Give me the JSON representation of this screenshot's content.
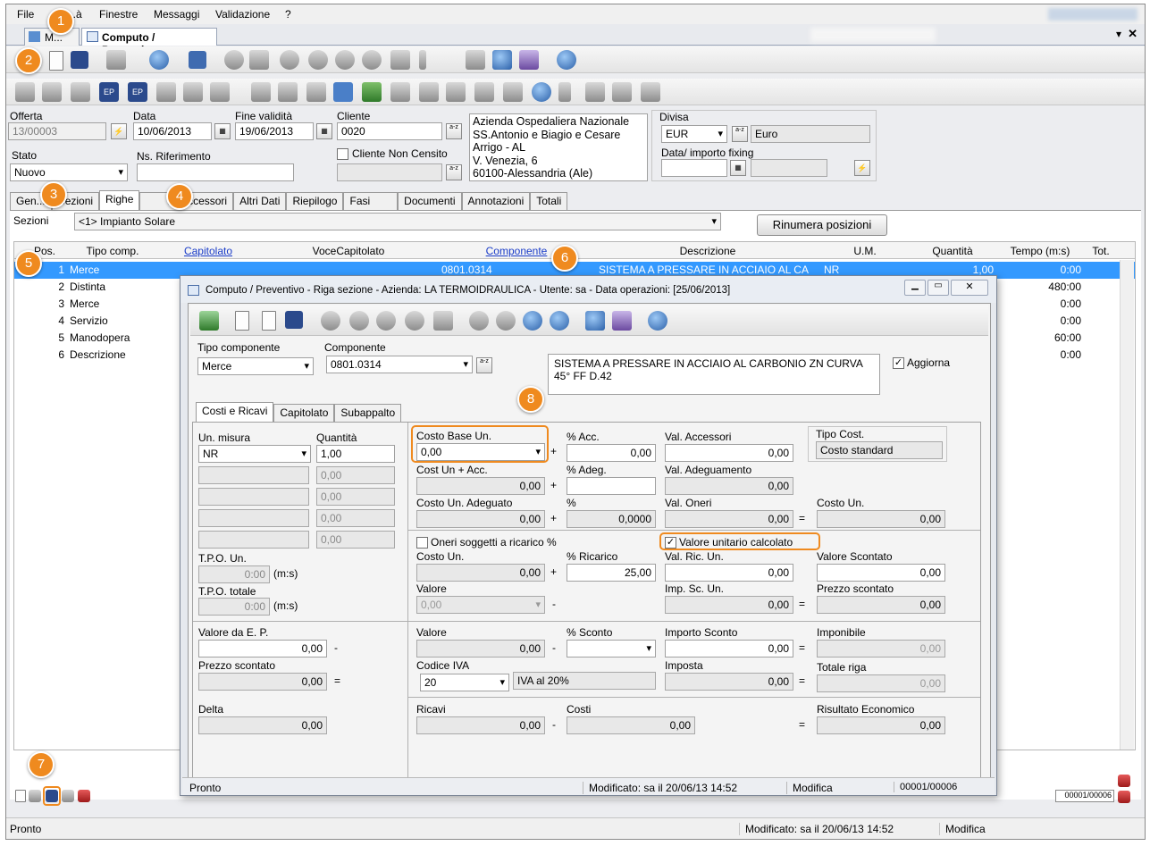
{
  "menu": [
    "File",
    "...à",
    "Finestre",
    "Messaggi",
    "Validazione",
    "?"
  ],
  "doc_tabs": {
    "first": "M...",
    "active": "Computo / Preventivo"
  },
  "header": {
    "offerta_label": "Offerta",
    "offerta": "13/00003",
    "data_label": "Data",
    "data": "10/06/2013",
    "fine_label": "Fine validità",
    "fine": "19/06/2013",
    "cliente_label": "Cliente",
    "cliente": "0020",
    "address": [
      "Azienda Ospedaliera Nazionale",
      "SS.Antonio e Biagio e Cesare",
      "Arrigo - AL",
      "V. Venezia, 6",
      "60100-Alessandria (Ale)"
    ],
    "divisa_label": "Divisa",
    "divisa": "EUR",
    "divisa_desc": "Euro",
    "fixing_label": "Data/ importo fixing",
    "stato_label": "Stato",
    "stato": "Nuovo",
    "nsrif_label": "Ns. Riferimento",
    "non_censito_label": "Cliente Non Censito"
  },
  "main_tabs": [
    "Gen...",
    "Sezioni",
    "Righe",
    "...i accessori",
    "Altri Dati",
    "Riepilogo",
    "Fasi",
    "Documenti",
    "Annotazioni",
    "Totali"
  ],
  "sezioni_label": "Sezioni",
  "sezioni_value": "<1> Impianto Solare",
  "rinumera": "Rinumera posizioni",
  "grid": {
    "headers": [
      "Pos.",
      "Tipo comp.",
      "Capitolato",
      "VoceCapitolato",
      "Componente",
      "Descrizione",
      "U.M.",
      "Quantità",
      "Tempo (m:s)",
      "Tot."
    ],
    "rows": [
      {
        "pos": "1",
        "tipo": "Merce",
        "comp": "0801.0314",
        "desc": "SISTEMA A PRESSARE IN ACCIAIO AL CA",
        "um": "NR",
        "qta": "1,00",
        "tempo": "0:00"
      },
      {
        "pos": "2",
        "tipo": "Distinta",
        "tempo": "480:00"
      },
      {
        "pos": "3",
        "tipo": "Merce",
        "tempo": "0:00"
      },
      {
        "pos": "4",
        "tipo": "Servizio",
        "tempo": "0:00"
      },
      {
        "pos": "5",
        "tipo": "Manodopera",
        "tempo": "60:00"
      },
      {
        "pos": "6",
        "tipo": "Descrizione",
        "tempo": "0:00"
      }
    ]
  },
  "status": {
    "left": "Pronto",
    "mod": "Modificato: sa il 20/06/13 14:52",
    "mode": "Modifica",
    "counter": "00001/00006"
  },
  "badges": [
    "1",
    "2",
    "3",
    "4",
    "5",
    "6",
    "7",
    "8"
  ],
  "dialog": {
    "title": "Computo / Preventivo - Riga sezione - Azienda: LA TERMOIDRAULICA - Utente: sa - Data operazioni: [25/06/2013]",
    "tipo_comp_label": "Tipo componente",
    "tipo_comp": "Merce",
    "componente_label": "Componente",
    "componente": "0801.0314",
    "descrizione": "SISTEMA A PRESSARE IN ACCIAIO AL CARBONIO ZN CURVA 45° FF D.42",
    "aggiorna": "Aggiorna",
    "tabs": [
      "Costi e Ricavi",
      "Capitolato",
      "Subappalto"
    ],
    "un_misura_label": "Un. misura",
    "un_misura": "NR",
    "quantita_label": "Quantità",
    "quantita": "1,00",
    "zero": "0,00",
    "tpo_un_label": "T.P.O. Un.",
    "tpo_totale_label": "T.P.O. totale",
    "tpo_val": "0:00",
    "ms": "(m:s)",
    "costo_base_label": "Costo Base Un.",
    "costo_base": "0,00",
    "acc_label": "% Acc.",
    "acc": "0,00",
    "val_acc_label": "Val. Accessori",
    "val_acc": "0,00",
    "tipo_cost_label": "Tipo Cost.",
    "tipo_cost": "Costo standard",
    "cost_un_acc_label": "Cost Un + Acc.",
    "cost_un_acc": "0,00",
    "adeg_label": "% Adeg.",
    "val_adeg_label": "Val. Adeguamento",
    "val_adeg": "0,00",
    "costo_un_adeg_label": "Costo Un. Adeguato",
    "costo_un_adeg": "0,00",
    "perc_label": "%",
    "perc": "0,0000",
    "val_oneri_label": "Val. Oneri",
    "val_oneri": "0,00",
    "costo_un_label": "Costo Un.",
    "costo_un": "0,00",
    "oneri_ricarico": "Oneri soggetti a ricarico %",
    "valore_unitario": "Valore unitario calcolato",
    "costo_un2_label": "Costo Un.",
    "costo_un2": "0,00",
    "ricarico_label": "% Ricarico",
    "ricarico": "25,00",
    "val_ric_label": "Val. Ric. Un.",
    "val_ric": "0,00",
    "valore_scontato_label": "Valore Scontato",
    "valore_scontato": "0,00",
    "valore_label": "Valore",
    "valore": "0,00",
    "imp_sc_label": "Imp. Sc. Un.",
    "imp_sc": "0,00",
    "prezzo_scontato_label": "Prezzo scontato",
    "prezzo_scontato": "0,00",
    "valore_ep_label": "Valore da E. P.",
    "valore_ep": "0,00",
    "valore2_label": "Valore",
    "valore2": "0,00",
    "sconto_label": "% Sconto",
    "importo_sconto_label": "Importo Sconto",
    "importo_sconto": "0,00",
    "imponibile_label": "Imponibile",
    "imponibile": "0,00",
    "prezzo_sc2_label": "Prezzo scontato",
    "prezzo_sc2": "0,00",
    "codice_iva_label": "Codice IVA",
    "codice_iva": "20",
    "iva_desc": "IVA al 20%",
    "imposta_label": "Imposta",
    "imposta": "0,00",
    "totale_riga_label": "Totale riga",
    "totale_riga": "0,00",
    "delta_label": "Delta",
    "delta": "0,00",
    "ricavi_label": "Ricavi",
    "ricavi": "0,00",
    "costi_label": "Costi",
    "costi": "0,00",
    "risultato_label": "Risultato Economico",
    "risultato": "0,00",
    "status": {
      "left": "Pronto",
      "mod": "Modificato: sa il 20/06/13 14:52",
      "mode": "Modifica",
      "counter": "00001/00006"
    }
  },
  "ops": {
    "plus": "+",
    "minus": "-",
    "eq": "="
  },
  "scroll_counter": "00001/00006"
}
